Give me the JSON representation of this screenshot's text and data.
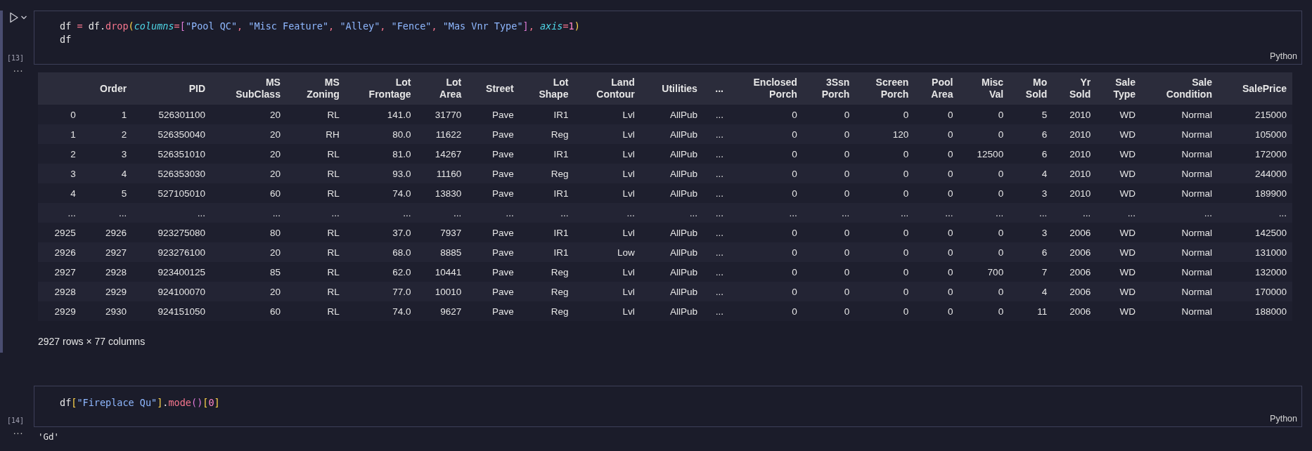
{
  "cells": [
    {
      "execution_count": "[13]",
      "language": "Python",
      "focused": true,
      "code_lines": [
        [
          {
            "t": "df",
            "kind": "var"
          },
          {
            "t": " = ",
            "kind": "op"
          },
          {
            "t": "df.",
            "kind": "var"
          },
          {
            "t": "drop",
            "kind": "func"
          },
          {
            "t": "(",
            "kind": "paren"
          },
          {
            "t": "columns",
            "kind": "param"
          },
          {
            "t": "=",
            "kind": "op"
          },
          {
            "t": "[",
            "kind": "bracket"
          },
          {
            "t": "\"Pool QC\"",
            "kind": "string"
          },
          {
            "t": ", ",
            "kind": "punct"
          },
          {
            "t": "\"Misc Feature\"",
            "kind": "string"
          },
          {
            "t": ", ",
            "kind": "punct"
          },
          {
            "t": "\"Alley\"",
            "kind": "string"
          },
          {
            "t": ", ",
            "kind": "punct"
          },
          {
            "t": "\"Fence\"",
            "kind": "string"
          },
          {
            "t": ", ",
            "kind": "punct"
          },
          {
            "t": "\"Mas Vnr Type\"",
            "kind": "string"
          },
          {
            "t": "]",
            "kind": "bracket"
          },
          {
            "t": ", ",
            "kind": "punct"
          },
          {
            "t": "axis",
            "kind": "param"
          },
          {
            "t": "=",
            "kind": "op"
          },
          {
            "t": "1",
            "kind": "number"
          },
          {
            "t": ")",
            "kind": "paren"
          }
        ],
        [
          {
            "t": "df",
            "kind": "var"
          }
        ]
      ],
      "output": {
        "marker": "...",
        "kind": "table",
        "columns": [
          "",
          "Order",
          "PID",
          "MS\nSubClass",
          "MS\nZoning",
          "Lot\nFrontage",
          "Lot\nArea",
          "Street",
          "Lot\nShape",
          "Land\nContour",
          "Utilities",
          "...",
          "Enclosed\nPorch",
          "3Ssn\nPorch",
          "Screen\nPorch",
          "Pool\nArea",
          "Misc\nVal",
          "Mo\nSold",
          "Yr\nSold",
          "Sale\nType",
          "Sale\nCondition",
          "SalePrice"
        ],
        "rows": [
          [
            "0",
            "1",
            "526301100",
            "20",
            "RL",
            "141.0",
            "31770",
            "Pave",
            "IR1",
            "Lvl",
            "AllPub",
            "...",
            "0",
            "0",
            "0",
            "0",
            "0",
            "5",
            "2010",
            "WD",
            "Normal",
            "215000"
          ],
          [
            "1",
            "2",
            "526350040",
            "20",
            "RH",
            "80.0",
            "11622",
            "Pave",
            "Reg",
            "Lvl",
            "AllPub",
            "...",
            "0",
            "0",
            "120",
            "0",
            "0",
            "6",
            "2010",
            "WD",
            "Normal",
            "105000"
          ],
          [
            "2",
            "3",
            "526351010",
            "20",
            "RL",
            "81.0",
            "14267",
            "Pave",
            "IR1",
            "Lvl",
            "AllPub",
            "...",
            "0",
            "0",
            "0",
            "0",
            "12500",
            "6",
            "2010",
            "WD",
            "Normal",
            "172000"
          ],
          [
            "3",
            "4",
            "526353030",
            "20",
            "RL",
            "93.0",
            "11160",
            "Pave",
            "Reg",
            "Lvl",
            "AllPub",
            "...",
            "0",
            "0",
            "0",
            "0",
            "0",
            "4",
            "2010",
            "WD",
            "Normal",
            "244000"
          ],
          [
            "4",
            "5",
            "527105010",
            "60",
            "RL",
            "74.0",
            "13830",
            "Pave",
            "IR1",
            "Lvl",
            "AllPub",
            "...",
            "0",
            "0",
            "0",
            "0",
            "0",
            "3",
            "2010",
            "WD",
            "Normal",
            "189900"
          ],
          [
            "...",
            "...",
            "...",
            "...",
            "...",
            "...",
            "...",
            "...",
            "...",
            "...",
            "...",
            "...",
            "...",
            "...",
            "...",
            "...",
            "...",
            "...",
            "...",
            "...",
            "...",
            "..."
          ],
          [
            "2925",
            "2926",
            "923275080",
            "80",
            "RL",
            "37.0",
            "7937",
            "Pave",
            "IR1",
            "Lvl",
            "AllPub",
            "...",
            "0",
            "0",
            "0",
            "0",
            "0",
            "3",
            "2006",
            "WD",
            "Normal",
            "142500"
          ],
          [
            "2926",
            "2927",
            "923276100",
            "20",
            "RL",
            "68.0",
            "8885",
            "Pave",
            "IR1",
            "Low",
            "AllPub",
            "...",
            "0",
            "0",
            "0",
            "0",
            "0",
            "6",
            "2006",
            "WD",
            "Normal",
            "131000"
          ],
          [
            "2927",
            "2928",
            "923400125",
            "85",
            "RL",
            "62.0",
            "10441",
            "Pave",
            "Reg",
            "Lvl",
            "AllPub",
            "...",
            "0",
            "0",
            "0",
            "0",
            "700",
            "7",
            "2006",
            "WD",
            "Normal",
            "132000"
          ],
          [
            "2928",
            "2929",
            "924100070",
            "20",
            "RL",
            "77.0",
            "10010",
            "Pave",
            "Reg",
            "Lvl",
            "AllPub",
            "...",
            "0",
            "0",
            "0",
            "0",
            "0",
            "4",
            "2006",
            "WD",
            "Normal",
            "170000"
          ],
          [
            "2929",
            "2930",
            "924151050",
            "60",
            "RL",
            "74.0",
            "9627",
            "Pave",
            "Reg",
            "Lvl",
            "AllPub",
            "...",
            "0",
            "0",
            "0",
            "0",
            "0",
            "11",
            "2006",
            "WD",
            "Normal",
            "188000"
          ]
        ],
        "caption": "2927 rows × 77 columns"
      }
    },
    {
      "execution_count": "[14]",
      "language": "Python",
      "focused": false,
      "code_lines": [
        [
          {
            "t": "df",
            "kind": "var"
          },
          {
            "t": "[",
            "kind": "paren"
          },
          {
            "t": "\"Fireplace Qu\"",
            "kind": "string"
          },
          {
            "t": "]",
            "kind": "paren"
          },
          {
            "t": ".",
            "kind": "var"
          },
          {
            "t": "mode",
            "kind": "func"
          },
          {
            "t": "()",
            "kind": "bracket"
          },
          {
            "t": "[",
            "kind": "paren"
          },
          {
            "t": "0",
            "kind": "number"
          },
          {
            "t": "]",
            "kind": "paren"
          }
        ]
      ],
      "output": {
        "marker": "...",
        "kind": "text",
        "text": "'Gd'"
      }
    }
  ]
}
